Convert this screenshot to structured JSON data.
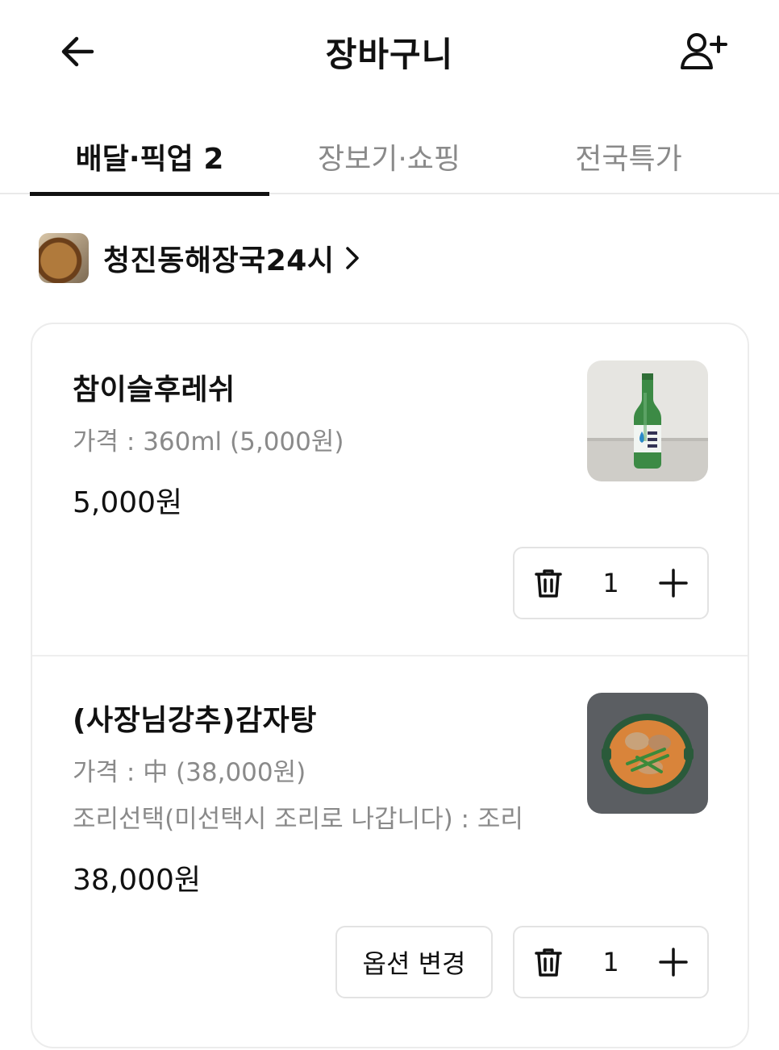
{
  "header": {
    "title": "장바구니"
  },
  "tabs": [
    {
      "label": "배달·픽업 2",
      "active": true
    },
    {
      "label": "장보기·쇼핑",
      "active": false
    },
    {
      "label": "전국특가",
      "active": false
    }
  ],
  "store": {
    "name": "청진동해장국24시"
  },
  "items": [
    {
      "name": "참이슬후레쉬",
      "options": [
        "가격 : 360ml (5,000원)"
      ],
      "price": "5,000원",
      "quantity": "1"
    },
    {
      "name": "(사장님강추)감자탕",
      "options": [
        "가격 : 中 (38,000원)",
        "조리선택(미선택시 조리로 나갑니다) : 조리"
      ],
      "price": "38,000원",
      "quantity": "1",
      "option_change_label": "옵션 변경"
    }
  ],
  "icons": {
    "back": "arrow-left-icon",
    "invite": "add-person-icon",
    "chevron": "chevron-right-icon",
    "delete": "trash-icon",
    "increase": "plus-icon"
  }
}
